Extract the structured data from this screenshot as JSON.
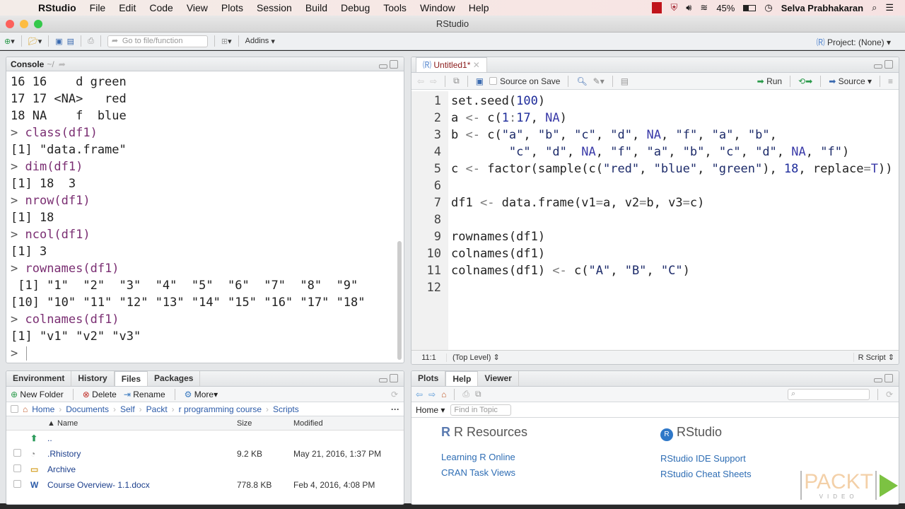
{
  "menubar": {
    "app": "RStudio",
    "items": [
      "File",
      "Edit",
      "Code",
      "View",
      "Plots",
      "Session",
      "Build",
      "Debug",
      "Tools",
      "Window",
      "Help"
    ],
    "battery": "45%",
    "user": "Selva Prabhakaran"
  },
  "window": {
    "title": "RStudio"
  },
  "toolbar": {
    "goto_placeholder": "Go to file/function",
    "addins": "Addins",
    "project": "Project: (None)"
  },
  "console": {
    "tab": "Console",
    "path": "~/",
    "lines": [
      {
        "type": "out",
        "text": "16 16    d green"
      },
      {
        "type": "out",
        "text": "17 17 <NA>   red"
      },
      {
        "type": "out",
        "text": "18 NA    f  blue"
      },
      {
        "type": "cmd",
        "text": "class(df1)"
      },
      {
        "type": "out",
        "text": "[1] \"data.frame\""
      },
      {
        "type": "cmd",
        "text": "dim(df1)"
      },
      {
        "type": "out",
        "text": "[1] 18  3"
      },
      {
        "type": "cmd",
        "text": "nrow(df1)"
      },
      {
        "type": "out",
        "text": "[1] 18"
      },
      {
        "type": "cmd",
        "text": "ncol(df1)"
      },
      {
        "type": "out",
        "text": "[1] 3"
      },
      {
        "type": "cmd",
        "text": "rownames(df1)"
      },
      {
        "type": "out",
        "text": " [1] \"1\"  \"2\"  \"3\"  \"4\"  \"5\"  \"6\"  \"7\"  \"8\"  \"9\""
      },
      {
        "type": "out",
        "text": "[10] \"10\" \"11\" \"12\" \"13\" \"14\" \"15\" \"16\" \"17\" \"18\""
      },
      {
        "type": "cmd",
        "text": "colnames(df1)"
      },
      {
        "type": "out",
        "text": "[1] \"v1\" \"v2\" \"v3\""
      },
      {
        "type": "prompt",
        "text": ""
      }
    ]
  },
  "editor": {
    "tab": "Untitled1*",
    "source_on_save": "Source on Save",
    "run": "Run",
    "source": "Source",
    "code": [
      "set.seed(100)",
      "a <- c(1:17, NA)",
      "b <- c(\"a\", \"b\", \"c\", \"d\", NA, \"f\", \"a\", \"b\",",
      "        \"c\", \"d\", NA, \"f\", \"a\", \"b\", \"c\", \"d\", NA, \"f\")",
      "c <- factor(sample(c(\"red\", \"blue\", \"green\"), 18, replace=T))",
      "",
      "df1 <- data.frame(v1=a, v2=b, v3=c)",
      "",
      "rownames(df1)",
      "colnames(df1)",
      "colnames(df1) <- c(\"A\", \"B\", \"C\")",
      ""
    ],
    "cursor": "11:1",
    "scope": "(Top Level)",
    "filetype": "R Script"
  },
  "files": {
    "tabs": [
      "Environment",
      "History",
      "Files",
      "Packages"
    ],
    "active_tab": "Files",
    "actions": {
      "new_folder": "New Folder",
      "delete": "Delete",
      "rename": "Rename",
      "more": "More"
    },
    "breadcrumb": [
      "Home",
      "Documents",
      "Self",
      "Packt",
      "r programming course",
      "Scripts"
    ],
    "columns": {
      "name": "Name",
      "size": "Size",
      "modified": "Modified"
    },
    "rows": [
      {
        "name": "..",
        "size": "",
        "modified": "",
        "icon": "up-arrow"
      },
      {
        "name": ".Rhistory",
        "size": "9.2 KB",
        "modified": "May 21, 2016, 1:37 PM",
        "icon": "history-file"
      },
      {
        "name": "Archive",
        "size": "",
        "modified": "",
        "icon": "folder"
      },
      {
        "name": "Course Overview- 1.1.docx",
        "size": "778.8 KB",
        "modified": "Feb 4, 2016, 4:08 PM",
        "icon": "word-doc"
      }
    ]
  },
  "help": {
    "tabs": [
      "Plots",
      "Help",
      "Viewer"
    ],
    "active_tab": "Help",
    "home": "Home",
    "find_placeholder": "Find in Topic",
    "r_resources": "R Resources",
    "rstudio": "RStudio",
    "left_links": [
      "Learning R Online",
      "CRAN Task Views"
    ],
    "right_links": [
      "RStudio IDE Support",
      "RStudio Cheat Sheets"
    ]
  },
  "watermark": {
    "brand": "PACKT",
    "sub": "VIDEO"
  }
}
